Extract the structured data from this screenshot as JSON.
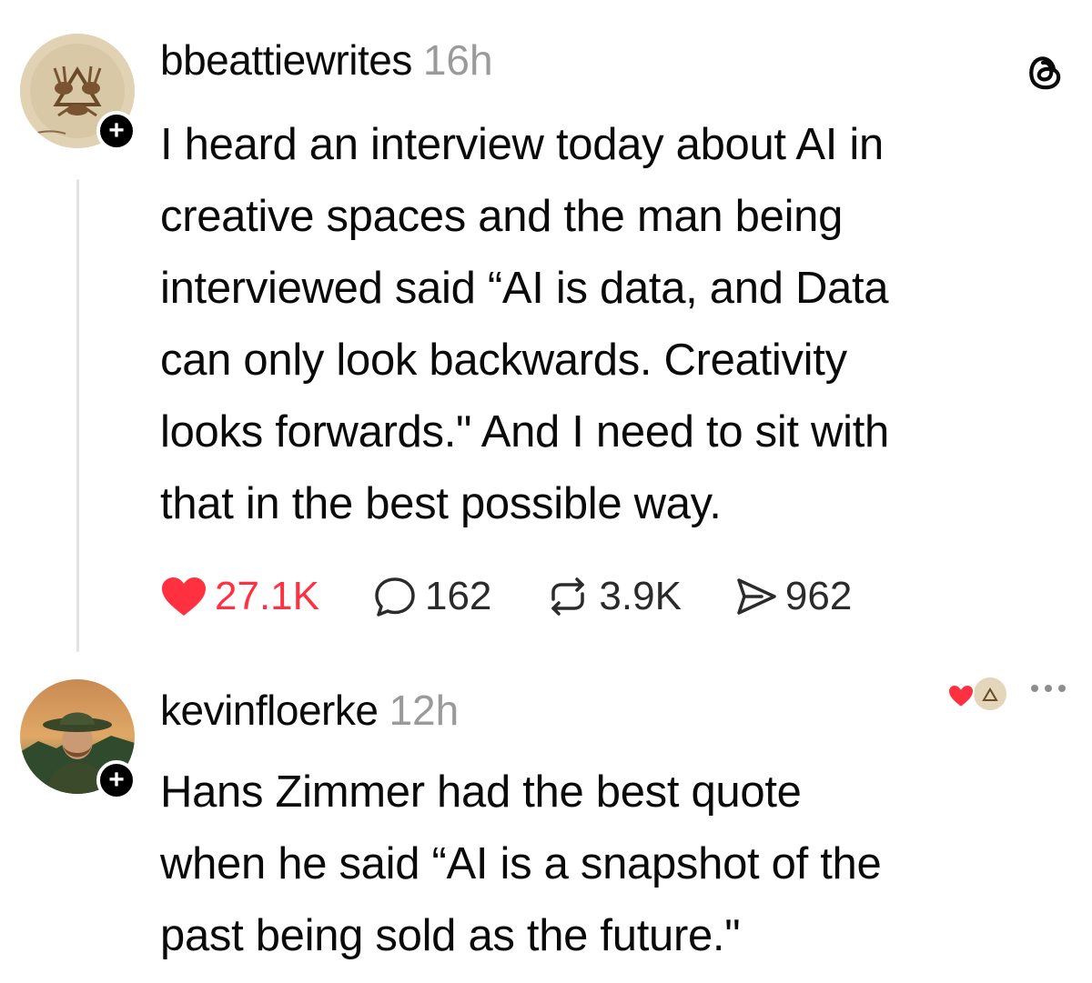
{
  "posts": [
    {
      "username": "bbeattiewrites",
      "time": "16h",
      "avatar_icon": "rabbits-illustration-avatar",
      "follow_icon": "plus-icon",
      "follow_glyph": "+",
      "text_lines": [
        "I heard an interview today about AI in",
        "creative spaces and the man being",
        "interviewed said “AI is data, and Data",
        "can only look backwards. Creativity",
        "looks forwards.\" And I need to sit with",
        "that in the best possible way."
      ],
      "actions": {
        "likes": "27.1K",
        "replies": "162",
        "reposts": "3.9K",
        "shares": "962"
      }
    },
    {
      "username": "kevinfloerke",
      "time": "12h",
      "avatar_icon": "man-in-hat-avatar",
      "follow_icon": "plus-icon",
      "follow_glyph": "+",
      "text_lines": [
        "Hans Zimmer had the best quote",
        "when he said “AI is a snapshot of the",
        "past being sold as the future.\""
      ]
    }
  ],
  "icons": {
    "app_logo": "threads-logo-icon",
    "like": "heart-icon",
    "reply": "speech-bubble-icon",
    "repost": "repost-icon",
    "share": "send-icon",
    "more": "more-dots-icon"
  },
  "colors": {
    "like_red": "#ff3040",
    "time_gray": "#9a9a9a",
    "thread_line": "#e3e3e3"
  }
}
